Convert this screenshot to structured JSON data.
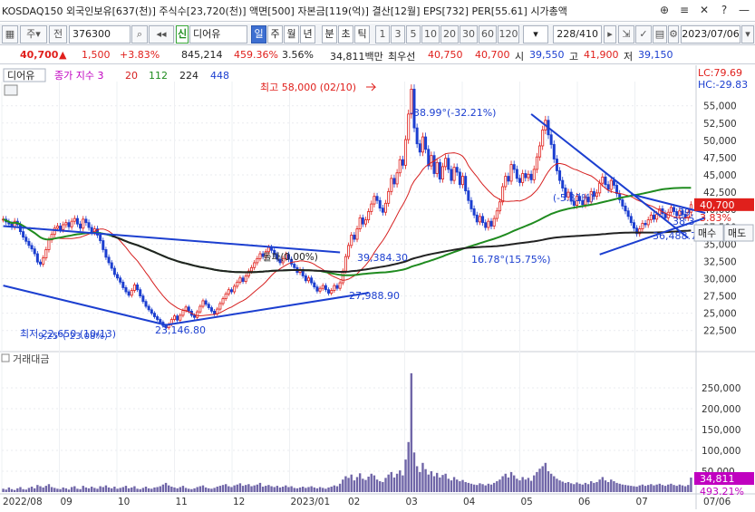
{
  "titlebar": {
    "info": "KOSDAQ150  외국인보유[637(천)]  주식수[23,720(천)]  액면[500]  자본금[119(억)]  결산[12월]  EPS[732]  PER[55.61]  시가총액",
    "buttons": [
      "⊕",
      "≡",
      "✕",
      "?",
      "—"
    ]
  },
  "toolbar": {
    "code": "376300",
    "stock_name": "디어유",
    "sin_label": "신",
    "day": "일",
    "week": "주",
    "month": "월",
    "year": "년",
    "minute": "분",
    "second": "초",
    "tick": "틱",
    "intervals": [
      "1",
      "3",
      "5",
      "10",
      "20",
      "30",
      "60",
      "120"
    ],
    "count": "228/410",
    "date": "2023/07/06",
    "buy": "매수",
    "sell": "매도",
    "gu_label": "주",
    "jeon_label": "전"
  },
  "pricebar": {
    "price": "40,700",
    "change": "1,500",
    "change_pct": "+3.83%",
    "volume": "845,214",
    "vol_ratio": "459.36%",
    "turnover": "3.56%",
    "amount": "34,811백만",
    "best_label": "최우선",
    "bid": "40,750",
    "ask": "40,700",
    "open_label": "시",
    "open": "39,550",
    "high_label": "고",
    "high": "41,900",
    "low_label": "저",
    "low": "39,150"
  },
  "chart": {
    "legend_name": "디어유",
    "ma_label": "종가 지수 3",
    "ma_periods": [
      "20",
      "112",
      "224",
      "448"
    ],
    "lc": "LC:79.69",
    "hc": "HC:-29.83",
    "volume_panel_label": "거래대금",
    "annotations": {
      "high": "최고 58,000 (02/10)",
      "low": "최저 22,650 (10/13)",
      "low_pct": "9,25°(-23.08%)",
      "trend1": "-38.99°(-32.21%)",
      "trend2": "16.78°(15.75%)",
      "breakout": "돌파(0.00%)",
      "tri_pct": "(-5.31%)",
      "level_1": "39,384.30",
      "level_2": "27,988.90",
      "level_3": "23,146.80",
      "level_4": "36,488.7",
      "level_5": "38,3",
      "level_6": "39,"
    },
    "current_price_label": "40,700",
    "current_pct_label": "3.83%",
    "volume_current_label": "34,811",
    "volume_pct_label": "493.21%",
    "last_date_label": "07/06"
  },
  "chart_data": {
    "type": "candlestick",
    "x_months": [
      "2022/08",
      "09",
      "10",
      "11",
      "12",
      "2023/01",
      "02",
      "03",
      "04",
      "05",
      "06",
      "07"
    ],
    "price_axis_ticks": [
      22500,
      25000,
      27500,
      30000,
      32500,
      35000,
      37500,
      40000,
      42500,
      45000,
      47500,
      50000,
      52500,
      55000
    ],
    "price_ylim": [
      20500,
      58500
    ],
    "volume_axis_ticks": [
      50000,
      100000,
      150000,
      200000,
      250000
    ],
    "volume_ylim": [
      0,
      300000
    ],
    "close_series": [
      38600,
      38200,
      37900,
      37500,
      38300,
      37800,
      36800,
      36000,
      35400,
      34800,
      34300,
      33600,
      32400,
      32100,
      33000,
      34200,
      35600,
      36400,
      37300,
      37600,
      37100,
      37800,
      38100,
      37500,
      38300,
      38700,
      37900,
      37300,
      38600,
      38100,
      37400,
      36700,
      37200,
      36300,
      35500,
      34200,
      33100,
      32300,
      31500,
      30600,
      30100,
      29500,
      28700,
      28100,
      27600,
      28300,
      29100,
      28400,
      27500,
      26700,
      26000,
      25500,
      25000,
      24500,
      24100,
      23700,
      23200,
      22900,
      23400,
      24100,
      24600,
      24000,
      24700,
      25400,
      25900,
      25300,
      24700,
      24400,
      25200,
      26000,
      26800,
      26300,
      25800,
      25300,
      24900,
      25600,
      26400,
      27100,
      27800,
      28400,
      28100,
      28900,
      29500,
      30100,
      29600,
      30400,
      31100,
      31600,
      32300,
      32900,
      33600,
      33200,
      33900,
      34500,
      34100,
      33500,
      32800,
      32300,
      32900,
      33500,
      32800,
      32100,
      31600,
      30900,
      31300,
      30400,
      29700,
      30100,
      29400,
      28800,
      28200,
      28600,
      29000,
      28400,
      27900,
      28300,
      29000,
      28600,
      29400,
      31100,
      33200,
      34800,
      36300,
      35700,
      37200,
      38800,
      37900,
      38500,
      39700,
      40800,
      41900,
      41300,
      40200,
      39600,
      40900,
      42600,
      44500,
      43700,
      45300,
      47200,
      46400,
      50100,
      53800,
      57400,
      51800,
      49500,
      48300,
      50500,
      48700,
      46300,
      47800,
      45200,
      46800,
      44400,
      46200,
      47400,
      45800,
      44200,
      46100,
      45400,
      43600,
      44800,
      42700,
      41300,
      40100,
      39200,
      38200,
      39000,
      38100,
      37400,
      38300,
      37600,
      38700,
      39800,
      41100,
      43300,
      44800,
      44100,
      46500,
      45800,
      44500,
      43900,
      45200,
      44600,
      45100,
      44300,
      45800,
      47600,
      49200,
      51500,
      52900,
      50800,
      49400,
      47300,
      45600,
      44200,
      43100,
      41800,
      42500,
      41200,
      40600,
      41900,
      41300,
      40700,
      41800,
      41100,
      42600,
      41900,
      42400,
      43800,
      44700,
      43600,
      42900,
      44200,
      43500,
      42300,
      41400,
      40500,
      39800,
      39000,
      38100,
      37300,
      36500,
      37200,
      38000,
      37800,
      38500,
      39200,
      38600,
      39300,
      40100,
      39400,
      38800,
      39600,
      40300,
      39700,
      39100,
      39800,
      39300,
      38800,
      39600,
      40700
    ],
    "volume_series": [
      8000,
      6000,
      11000,
      7000,
      5000,
      9000,
      12000,
      7000,
      6000,
      10000,
      13000,
      9000,
      17000,
      14000,
      11000,
      15000,
      19000,
      12000,
      10000,
      8000,
      7000,
      11000,
      9000,
      6000,
      12000,
      14000,
      8000,
      7000,
      15000,
      11000,
      9000,
      13000,
      10000,
      8000,
      14000,
      12000,
      16000,
      11000,
      9000,
      13000,
      8000,
      10000,
      12000,
      15000,
      9000,
      11000,
      14000,
      8000,
      7000,
      10000,
      13000,
      9000,
      8000,
      11000,
      12000,
      14000,
      18000,
      22000,
      16000,
      13000,
      11000,
      9000,
      12000,
      15000,
      10000,
      8000,
      7000,
      9000,
      12000,
      14000,
      16000,
      11000,
      9000,
      8000,
      10000,
      13000,
      15000,
      17000,
      19000,
      14000,
      12000,
      16000,
      18000,
      21000,
      15000,
      17000,
      19000,
      14000,
      16000,
      18000,
      22000,
      13000,
      15000,
      17000,
      14000,
      12000,
      15000,
      11000,
      13000,
      16000,
      12000,
      14000,
      10000,
      9000,
      11000,
      13000,
      10000,
      12000,
      14000,
      11000,
      9000,
      12000,
      10000,
      8000,
      11000,
      13000,
      16000,
      14000,
      20000,
      30000,
      38000,
      34000,
      42000,
      28000,
      36000,
      45000,
      32000,
      29000,
      37000,
      44000,
      40000,
      30000,
      26000,
      24000,
      34000,
      42000,
      48000,
      35000,
      44000,
      52000,
      40000,
      78000,
      120000,
      285000,
      95000,
      62000,
      48000,
      70000,
      55000,
      42000,
      50000,
      38000,
      46000,
      35000,
      41000,
      44000,
      32000,
      28000,
      36000,
      30000,
      26000,
      29000,
      24000,
      22000,
      20000,
      18000,
      17000,
      21000,
      19000,
      16000,
      20000,
      18000,
      22000,
      26000,
      30000,
      38000,
      44000,
      35000,
      48000,
      40000,
      32000,
      28000,
      36000,
      30000,
      34000,
      27000,
      40000,
      48000,
      56000,
      62000,
      70000,
      50000,
      44000,
      38000,
      32000,
      28000,
      25000,
      22000,
      24000,
      21000,
      19000,
      23000,
      20000,
      18000,
      22000,
      19000,
      26000,
      22000,
      24000,
      30000,
      36000,
      28000,
      24000,
      30000,
      26000,
      22000,
      20000,
      18000,
      17000,
      16000,
      15000,
      14000,
      13000,
      16000,
      18000,
      15000,
      17000,
      19000,
      16000,
      18000,
      20000,
      17000,
      15000,
      18000,
      20000,
      17000,
      15000,
      18000,
      16000,
      14000,
      17000,
      34811
    ]
  }
}
